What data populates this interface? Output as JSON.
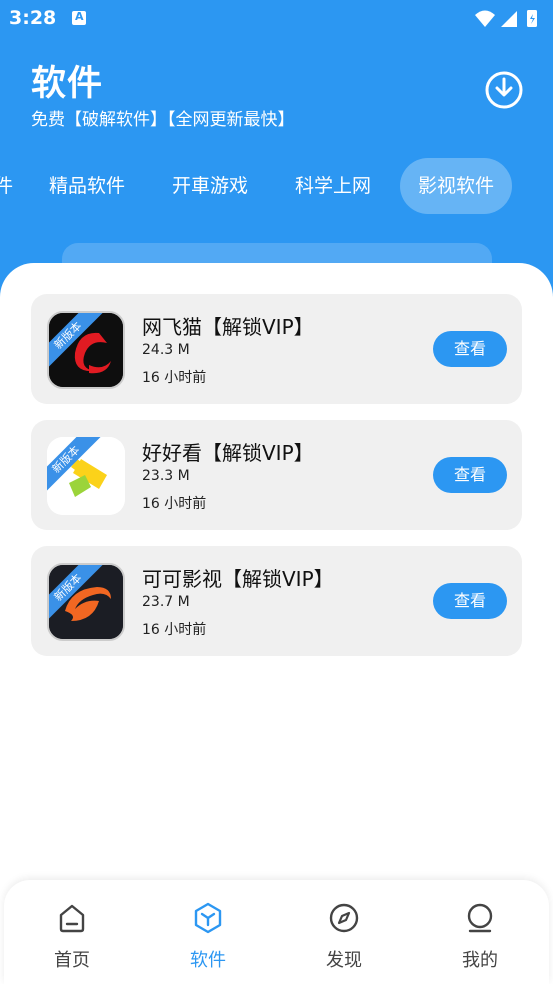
{
  "status_bar": {
    "time": "3:28"
  },
  "header": {
    "title": "软件",
    "subtitle": "免费【破解软件】【全网更新最快】"
  },
  "tabs": [
    {
      "label": "件"
    },
    {
      "label": "精品软件"
    },
    {
      "label": "开車游戏"
    },
    {
      "label": "科学上网"
    },
    {
      "label": "影视软件",
      "active": true
    }
  ],
  "apps": [
    {
      "name": "网飞猫【解锁VIP】",
      "size": "24.3 M",
      "time": "16 小时前",
      "badge": "新版本",
      "button": "查看"
    },
    {
      "name": "好好看【解锁VIP】",
      "size": "23.3 M",
      "time": "16 小时前",
      "badge": "新版本",
      "button": "查看"
    },
    {
      "name": "可可影视【解锁VIP】",
      "size": "23.7 M",
      "time": "16 小时前",
      "badge": "新版本",
      "button": "查看"
    }
  ],
  "bottom_nav": [
    {
      "label": "首页",
      "icon": "home-icon"
    },
    {
      "label": "软件",
      "icon": "cube-icon",
      "active": true
    },
    {
      "label": "发现",
      "icon": "compass-icon"
    },
    {
      "label": "我的",
      "icon": "profile-icon"
    }
  ],
  "colors": {
    "primary": "#2c97f2",
    "card_bg": "#f0f0f0",
    "badge": "#3a91e8"
  }
}
